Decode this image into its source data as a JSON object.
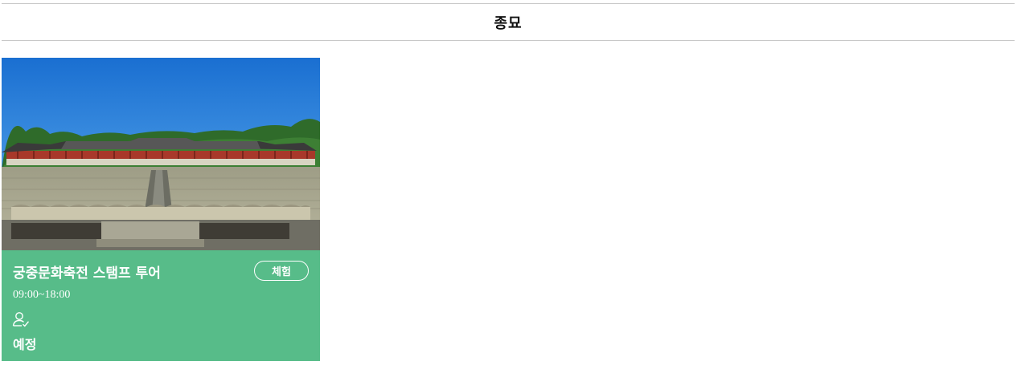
{
  "section": {
    "title": "종묘"
  },
  "card": {
    "title": "궁중문화축전 스탬프 투어",
    "badge": "체험",
    "time": "09:00~18:00",
    "icon": "person-check-icon",
    "status": "예정",
    "background_color": "#57bc89",
    "image": "jongmyo-shrine-photo"
  }
}
